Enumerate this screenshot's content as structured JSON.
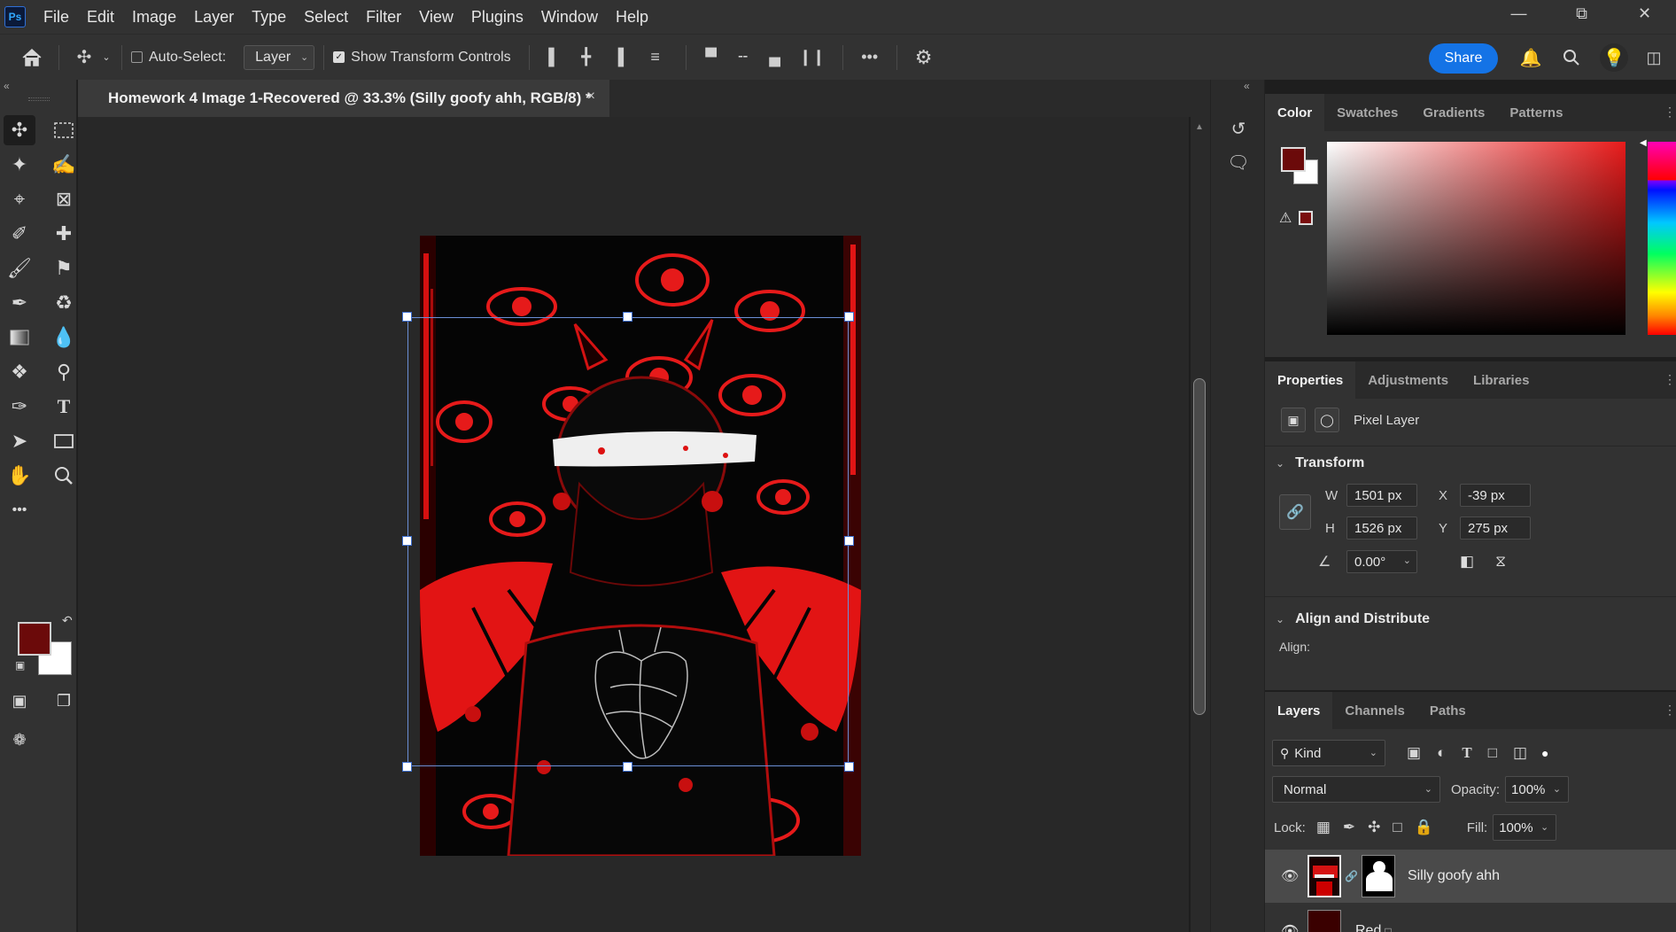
{
  "app": {
    "logo": "Ps"
  },
  "menu": [
    "File",
    "Edit",
    "Image",
    "Layer",
    "Type",
    "Select",
    "Filter",
    "View",
    "Plugins",
    "Window",
    "Help"
  ],
  "options_bar": {
    "auto_select_label": "Auto-Select:",
    "auto_select_checked": false,
    "auto_select_target": "Layer",
    "show_transform_label": "Show Transform Controls",
    "show_transform_checked": true,
    "share_label": "Share"
  },
  "document": {
    "tab_title": "Homework 4 Image 1-Recovered @ 33.3% (Silly goofy ahh, RGB/8) *",
    "close_glyph": "×"
  },
  "toolbar": {
    "foreground_color": "#6b0a0a",
    "background_color": "#ffffff",
    "more_glyph": "•••"
  },
  "color_panel": {
    "tabs": [
      "Color",
      "Swatches",
      "Gradients",
      "Patterns"
    ],
    "active_tab": "Color",
    "foreground_color": "#6b0a0a",
    "background_color": "#ffffff"
  },
  "properties_panel": {
    "tabs": [
      "Properties",
      "Adjustments",
      "Libraries"
    ],
    "active_tab": "Properties",
    "layer_type": "Pixel Layer",
    "transform": {
      "title": "Transform",
      "w_label": "W",
      "w": "1501 px",
      "h_label": "H",
      "h": "1526 px",
      "x_label": "X",
      "x": "-39 px",
      "y_label": "Y",
      "y": "275 px",
      "angle": "0.00°"
    },
    "align": {
      "title": "Align and Distribute",
      "label": "Align:"
    }
  },
  "layers_panel": {
    "tabs": [
      "Layers",
      "Channels",
      "Paths"
    ],
    "active_tab": "Layers",
    "filter_kind": "Kind",
    "blend_mode": "Normal",
    "opacity_label": "Opacity:",
    "opacity": "100%",
    "lock_label": "Lock:",
    "fill_label": "Fill:",
    "fill": "100%",
    "layers": [
      {
        "name": "Silly goofy ahh",
        "visible": true,
        "selected": true
      },
      {
        "name": "Red",
        "visible": true,
        "selected": false
      }
    ]
  }
}
